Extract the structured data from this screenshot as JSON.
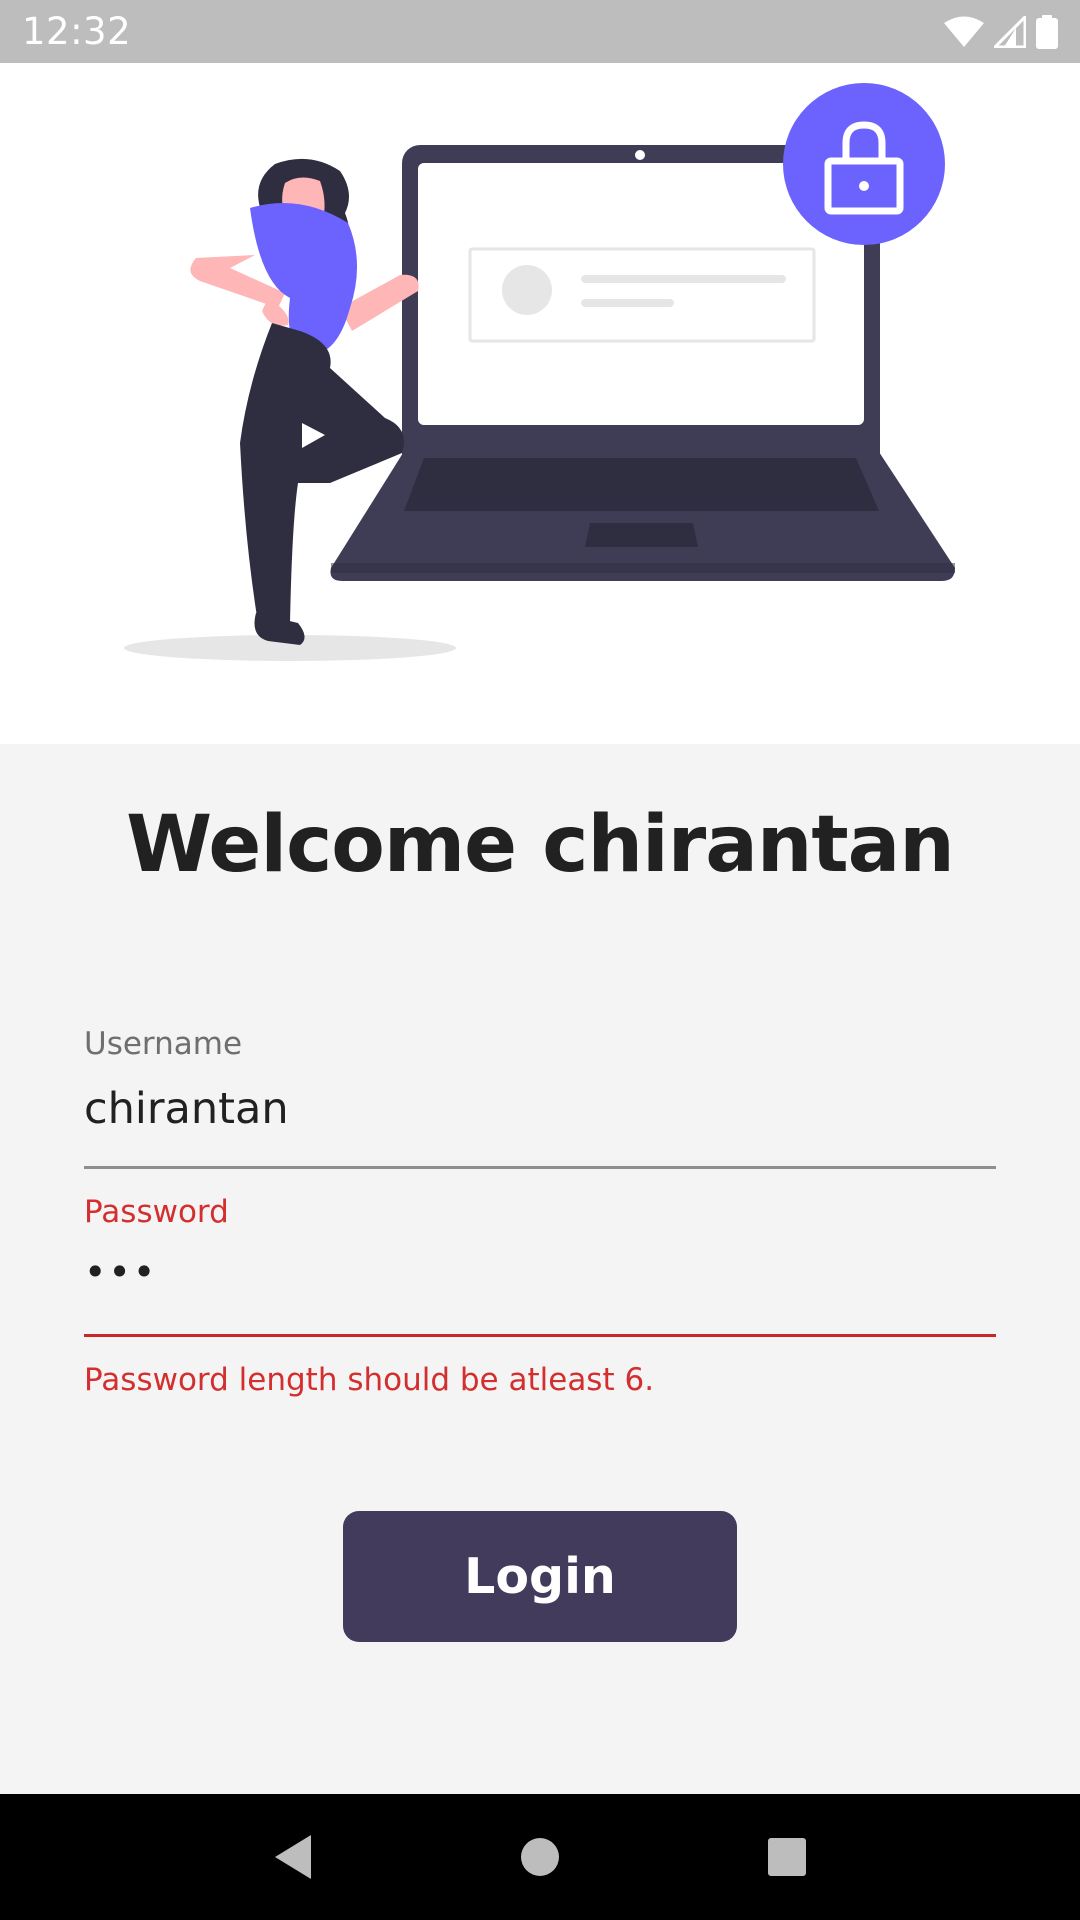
{
  "status_bar": {
    "time": "12:32"
  },
  "colors": {
    "accent": "#6c63ff",
    "button": "#423b5c",
    "error": "#d32f2f",
    "laptop": "#3f3d56",
    "skin": "#ffb6b6"
  },
  "form": {
    "welcome_title": "Welcome chirantan",
    "username": {
      "label": "Username",
      "value": "chirantan"
    },
    "password": {
      "label": "Password",
      "value": "•••",
      "error": "Password length should be atleast 6."
    },
    "login_label": "Login"
  },
  "icons": {
    "wifi": "wifi-icon",
    "signal": "signal-icon",
    "battery": "battery-icon",
    "lock": "lock-icon",
    "back": "back-icon",
    "home": "home-icon",
    "recents": "recents-icon"
  }
}
